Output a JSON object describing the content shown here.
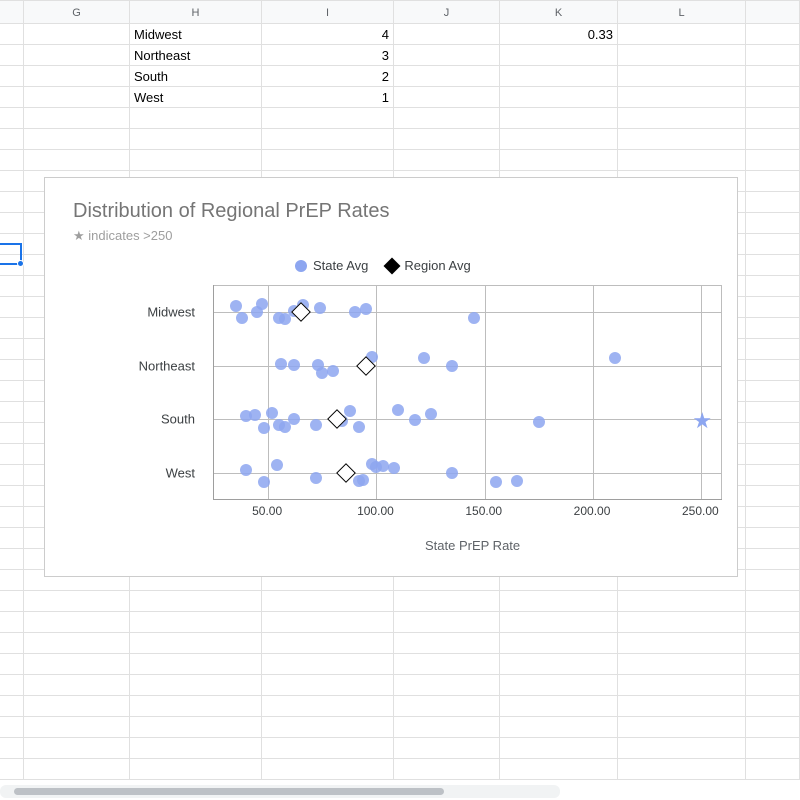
{
  "columns": [
    {
      "label": "",
      "width": 24
    },
    {
      "label": "G",
      "width": 106
    },
    {
      "label": "H",
      "width": 132
    },
    {
      "label": "I",
      "width": 132
    },
    {
      "label": "J",
      "width": 106
    },
    {
      "label": "K",
      "width": 118
    },
    {
      "label": "L",
      "width": 128
    },
    {
      "label": "",
      "width": 54
    }
  ],
  "cells": {
    "r1": {
      "H": "Midwest",
      "I": "4",
      "K": "0.33"
    },
    "r2": {
      "H": "Northeast",
      "I": "3"
    },
    "r3": {
      "H": "South",
      "I": "2"
    },
    "r4": {
      "H": "West",
      "I": "1"
    }
  },
  "chart_data": {
    "type": "scatter",
    "title": "Distribution of Regional PrEP Rates",
    "subtitle": "★ indicates >250",
    "xlabel": "State PrEP Rate",
    "ylabel": "",
    "xlim": [
      25,
      260
    ],
    "x_ticks": [
      50,
      100,
      150,
      200,
      250
    ],
    "x_tick_labels": [
      "50.00",
      "100.00",
      "150.00",
      "200.00",
      "250.00"
    ],
    "y_categories": [
      "Midwest",
      "Northeast",
      "South",
      "West"
    ],
    "legend": [
      {
        "name": "State Avg",
        "marker": "dot"
      },
      {
        "name": "Region Avg",
        "marker": "diamond"
      }
    ],
    "series": [
      {
        "name": "State Avg",
        "marker": "dot",
        "points": [
          {
            "y": "Midwest",
            "x": 35
          },
          {
            "y": "Midwest",
            "x": 38
          },
          {
            "y": "Midwest",
            "x": 45
          },
          {
            "y": "Midwest",
            "x": 47
          },
          {
            "y": "Midwest",
            "x": 55
          },
          {
            "y": "Midwest",
            "x": 58
          },
          {
            "y": "Midwest",
            "x": 62
          },
          {
            "y": "Midwest",
            "x": 66
          },
          {
            "y": "Midwest",
            "x": 74
          },
          {
            "y": "Midwest",
            "x": 90
          },
          {
            "y": "Midwest",
            "x": 95
          },
          {
            "y": "Midwest",
            "x": 145
          },
          {
            "y": "Northeast",
            "x": 56
          },
          {
            "y": "Northeast",
            "x": 62
          },
          {
            "y": "Northeast",
            "x": 73
          },
          {
            "y": "Northeast",
            "x": 75
          },
          {
            "y": "Northeast",
            "x": 80
          },
          {
            "y": "Northeast",
            "x": 98
          },
          {
            "y": "Northeast",
            "x": 122
          },
          {
            "y": "Northeast",
            "x": 135
          },
          {
            "y": "Northeast",
            "x": 210
          },
          {
            "y": "South",
            "x": 40
          },
          {
            "y": "South",
            "x": 44
          },
          {
            "y": "South",
            "x": 48
          },
          {
            "y": "South",
            "x": 52
          },
          {
            "y": "South",
            "x": 55
          },
          {
            "y": "South",
            "x": 58
          },
          {
            "y": "South",
            "x": 62
          },
          {
            "y": "South",
            "x": 72
          },
          {
            "y": "South",
            "x": 84
          },
          {
            "y": "South",
            "x": 88
          },
          {
            "y": "South",
            "x": 92
          },
          {
            "y": "South",
            "x": 110
          },
          {
            "y": "South",
            "x": 118
          },
          {
            "y": "South",
            "x": 125
          },
          {
            "y": "South",
            "x": 175
          },
          {
            "y": "West",
            "x": 40
          },
          {
            "y": "West",
            "x": 48
          },
          {
            "y": "West",
            "x": 54
          },
          {
            "y": "West",
            "x": 72
          },
          {
            "y": "West",
            "x": 92
          },
          {
            "y": "West",
            "x": 94
          },
          {
            "y": "West",
            "x": 98
          },
          {
            "y": "West",
            "x": 100
          },
          {
            "y": "West",
            "x": 103
          },
          {
            "y": "West",
            "x": 108
          },
          {
            "y": "West",
            "x": 135
          },
          {
            "y": "West",
            "x": 155
          },
          {
            "y": "West",
            "x": 165
          }
        ]
      },
      {
        "name": "Region Avg",
        "marker": "diamond",
        "points": [
          {
            "y": "Midwest",
            "x": 65
          },
          {
            "y": "Northeast",
            "x": 95
          },
          {
            "y": "South",
            "x": 82
          },
          {
            "y": "West",
            "x": 86
          }
        ]
      },
      {
        "name": ">250",
        "marker": "star",
        "points": [
          {
            "y": "South",
            "x": 250
          }
        ]
      }
    ]
  }
}
